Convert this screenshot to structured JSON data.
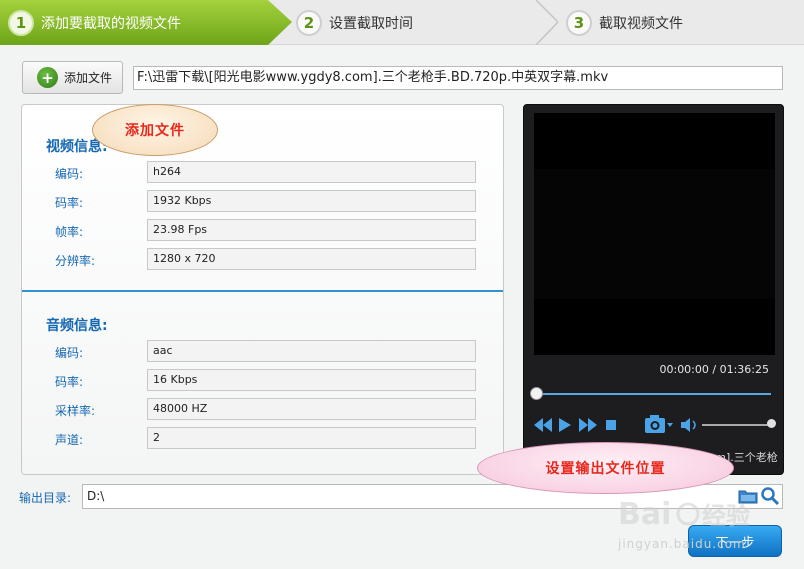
{
  "steps": [
    {
      "num": "1",
      "label": "添加要截取的视频文件",
      "active": true
    },
    {
      "num": "2",
      "label": "设置截取时间",
      "active": false
    },
    {
      "num": "3",
      "label": "截取视频文件",
      "active": false
    }
  ],
  "add_file": {
    "label": "添加文件",
    "icon": "plus-icon"
  },
  "file_path": "F:\\迅雷下载\\[阳光电影www.ygdy8.com].三个老枪手.BD.720p.中英双字幕.mkv",
  "video_info": {
    "title": "视频信息:",
    "rows": [
      {
        "label": "编码:",
        "value": "h264"
      },
      {
        "label": "码率:",
        "value": "1932 Kbps"
      },
      {
        "label": "帧率:",
        "value": "23.98 Fps"
      },
      {
        "label": "分辨率:",
        "value": "1280 x 720"
      }
    ]
  },
  "audio_info": {
    "title": "音频信息:",
    "rows": [
      {
        "label": "编码:",
        "value": "aac"
      },
      {
        "label": "码率:",
        "value": "16 Kbps"
      },
      {
        "label": "采样率:",
        "value": "48000 HZ"
      },
      {
        "label": "声道:",
        "value": "2"
      }
    ]
  },
  "player": {
    "timecode": "00:00:00 / 01:36:25",
    "current_file": "当前文件: [阳光电影www.ygdy8.com].三个老枪",
    "progress": 0,
    "controls": [
      "rewind-icon",
      "play-icon",
      "fast-forward-icon",
      "stop-icon",
      "camera-icon",
      "volume-icon"
    ]
  },
  "output": {
    "label": "输出目录:",
    "value": "D:\\"
  },
  "next_button": "下一步",
  "callouts": {
    "add_file": "添加文件",
    "output": "设置输出文件位置"
  },
  "watermark": {
    "text": "Baidu经验",
    "url": "jingyan.baidu.com"
  },
  "colors": {
    "accent_green": "#6da419",
    "accent_blue": "#1668b3",
    "button_blue": "#1a84d6",
    "callout_red": "#e8281c"
  }
}
